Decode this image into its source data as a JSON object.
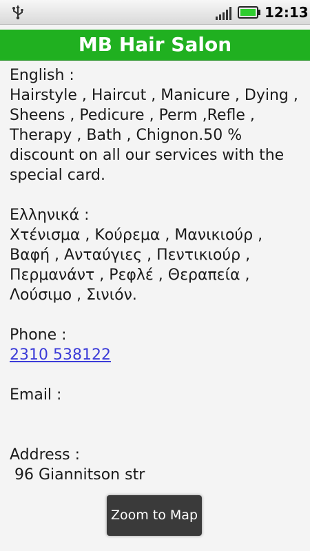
{
  "status_bar": {
    "time": "12:13",
    "icons": [
      "usb-icon",
      "signal-icon",
      "battery-icon"
    ],
    "battery_color": "#2ecc2e"
  },
  "app": {
    "title": "MB Hair Salon",
    "title_bar_color": "#20b020"
  },
  "details": {
    "english_heading": "English :",
    "english_text": "Hairstyle , Haircut , Manicure , Dying , Sheens , Pedicure , Perm ,Refle , Therapy , Bath , Chignon.50 % discount on all our services with the special card.",
    "greek_heading": "Ελληνικά :",
    "greek_text": "Χτένισμα , Κούρεμα , Μανικιούρ , Βαφή , Ανταύγιες , Πεντικιούρ , Περμανάντ , Ρεφλέ , Θεραπεία , Λούσιμο , Σινιόν.",
    "phone_heading": "Phone :",
    "phone_value": "2310 538122",
    "email_heading": "Email :",
    "address_heading": "Address :",
    "address_value": " 96 Giannitson str"
  },
  "zoom_button": {
    "label": "Zoom to Map"
  }
}
